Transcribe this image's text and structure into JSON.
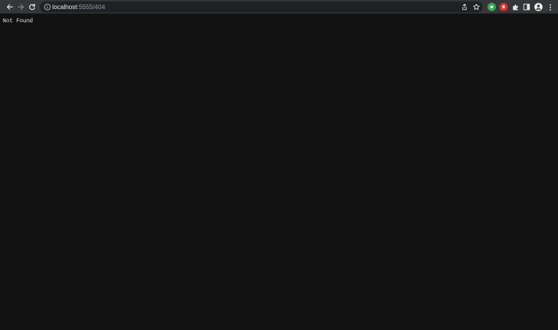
{
  "browser": {
    "address_bar": {
      "host": "localhost",
      "rest": ":5555/404"
    }
  },
  "page": {
    "message": "Not Found",
    "background": "#121212"
  },
  "colors": {
    "toolbar": "#35363a",
    "omnibox": "#202124",
    "ext_green": "#34a853",
    "ext_red": "#d93025"
  },
  "icons": [
    "back-icon",
    "forward-icon",
    "reload-icon",
    "info-icon",
    "share-icon",
    "star-icon",
    "extension-icon",
    "puzzle-icon",
    "side-panel-icon",
    "avatar",
    "menu-icon"
  ]
}
